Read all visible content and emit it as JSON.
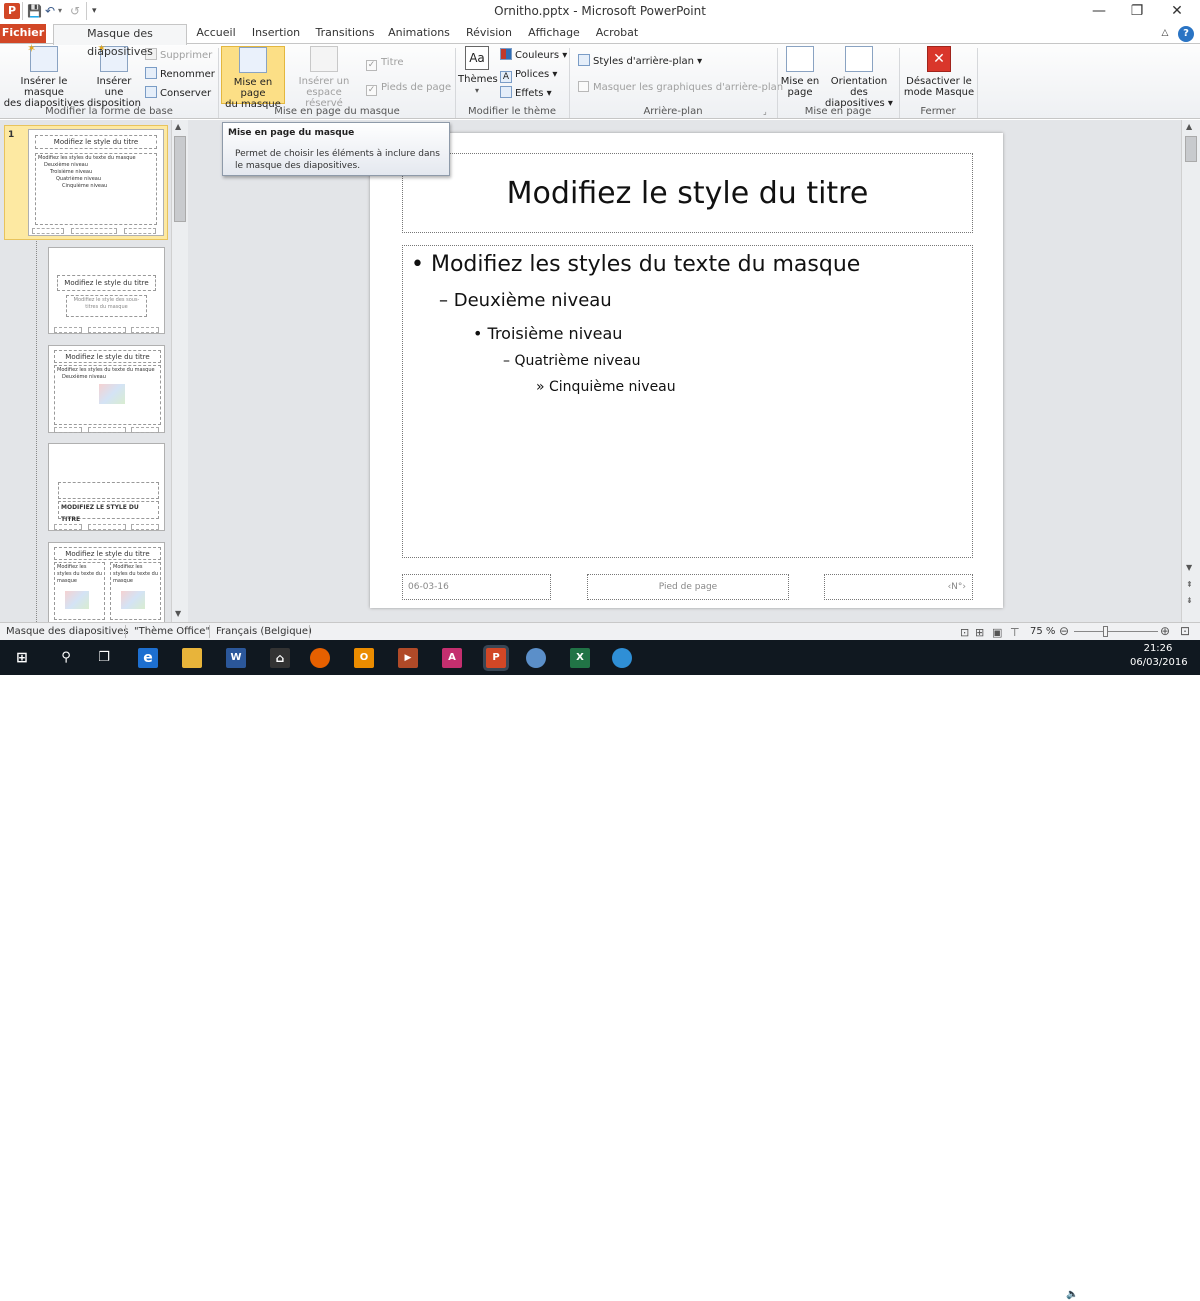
{
  "window": {
    "app_letter": "P",
    "title": "Ornitho.pptx - Microsoft PowerPoint",
    "minimize": "—",
    "restore": "❐",
    "close": "✕"
  },
  "tabs": {
    "fichier": "Fichier",
    "masque": "Masque des diapositives",
    "accueil": "Accueil",
    "insertion": "Insertion",
    "transitions": "Transitions",
    "animations": "Animations",
    "revision": "Révision",
    "affichage": "Affichage",
    "acrobat": "Acrobat"
  },
  "ribbon": {
    "groups": {
      "forme_base": "Modifier la forme de base",
      "mise_en_page_masque": "Mise en page du masque",
      "modifier_theme": "Modifier le thème",
      "arriere_plan": "Arrière-plan",
      "mise_en_page": "Mise en page",
      "fermer": "Fermer"
    },
    "inserer_masque_1": "Insérer le masque",
    "inserer_masque_2": "des diapositives",
    "inserer_disposition_1": "Insérer une",
    "inserer_disposition_2": "disposition",
    "supprimer": "Supprimer",
    "renommer": "Renommer",
    "conserver": "Conserver",
    "mise_en_page_masque_1": "Mise en page",
    "mise_en_page_masque_2": "du masque",
    "inserer_espace_1": "Insérer un",
    "inserer_espace_2": "espace réservé",
    "titre": "Titre",
    "pieds_de_page": "Pieds de page",
    "themes": "Thèmes",
    "couleurs": "Couleurs",
    "polices": "Polices",
    "effets": "Effets",
    "styles_arriere_plan": "Styles d'arrière-plan",
    "masquer_graphiques": "Masquer les graphiques d'arrière-plan",
    "mise_en_page_1": "Mise en",
    "mise_en_page_2": "page",
    "orientation_1": "Orientation des",
    "orientation_2": "diapositives",
    "desactiver_1": "Désactiver le",
    "desactiver_2": "mode Masque"
  },
  "tooltip": {
    "title": "Mise en page du masque",
    "description": "Permet de choisir les éléments à inclure dans le masque des diapositives."
  },
  "thumbnails": {
    "slide_number": "1",
    "title": "Modifiez le style du titre",
    "master_body": [
      "Modifiez les styles du texte du masque",
      "Deuxième niveau",
      "Troisième niveau",
      "Quatrième niveau",
      "Cinquième niveau"
    ],
    "layout2_body": "Modifiez le style des sous-titres du masque",
    "layout4_title": "MODIFIEZ LE STYLE DU TITRE"
  },
  "slide": {
    "title": "Modifiez le style du titre",
    "level1": "Modifiez les styles du texte du masque",
    "level2": "Deuxième niveau",
    "level3": "Troisième niveau",
    "level4": "Quatrième niveau",
    "level5": "Cinquième niveau",
    "date": "06-03-16",
    "footer": "Pied de page",
    "number": "‹N°›"
  },
  "status": {
    "view": "Masque des diapositives",
    "theme": "\"Thème Office\"",
    "language": "Français (Belgique)",
    "zoom": "75 %",
    "zoom_fraction": 0.75
  },
  "taskbar": {
    "time": "21:26",
    "date": "06/03/2016"
  },
  "colors": {
    "accent": "#d24726",
    "selected_button": "#fcdf86",
    "taskbar": "#101820"
  }
}
